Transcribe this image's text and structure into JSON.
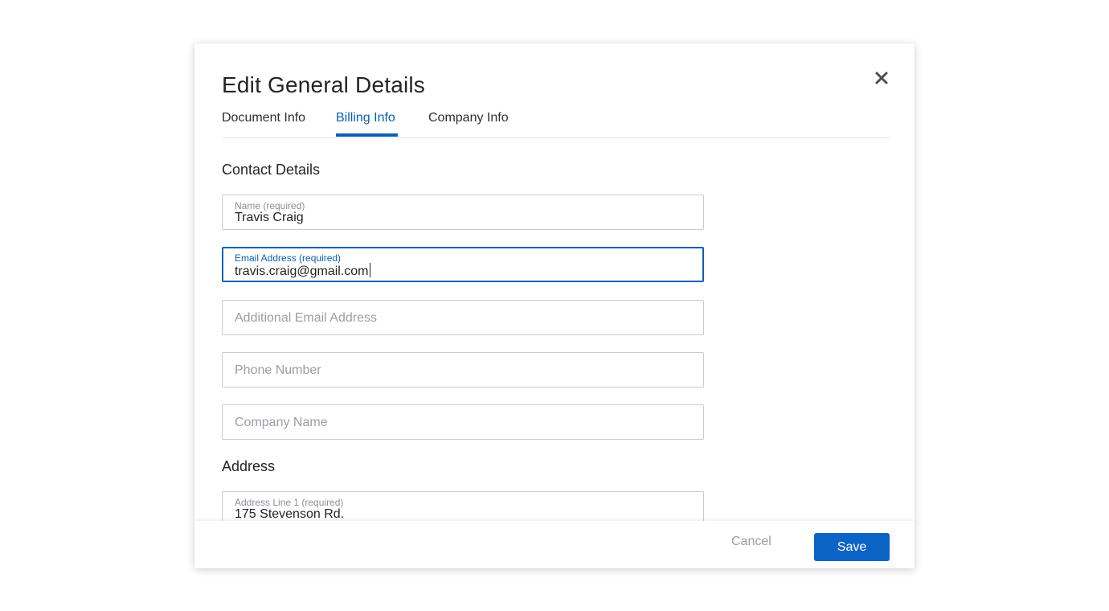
{
  "modal": {
    "title": "Edit General Details",
    "close_icon": "close-icon"
  },
  "tabs": [
    {
      "label": "Document Info",
      "active": false
    },
    {
      "label": "Billing Info",
      "active": true
    },
    {
      "label": "Company Info",
      "active": false
    }
  ],
  "contact_details": {
    "heading": "Contact Details",
    "name": {
      "label": "Name (required)",
      "value": "Travis Craig"
    },
    "email": {
      "label": "Email Address (required)",
      "value": "travis.craig@gmail.com"
    },
    "additional_email": {
      "placeholder": "Additional Email Address",
      "value": ""
    },
    "phone": {
      "placeholder": "Phone Number",
      "value": ""
    },
    "company": {
      "placeholder": "Company Name",
      "value": ""
    }
  },
  "address": {
    "heading": "Address",
    "line1": {
      "label": "Address Line 1 (required)",
      "value": "175 Stevenson Rd."
    }
  },
  "footer": {
    "cancel_label": "Cancel",
    "save_label": "Save"
  },
  "colors": {
    "accent": "#0b5fb5",
    "primary_button": "#0b63c5",
    "border": "#c8ccd2",
    "muted_text": "#9a9ea5"
  }
}
